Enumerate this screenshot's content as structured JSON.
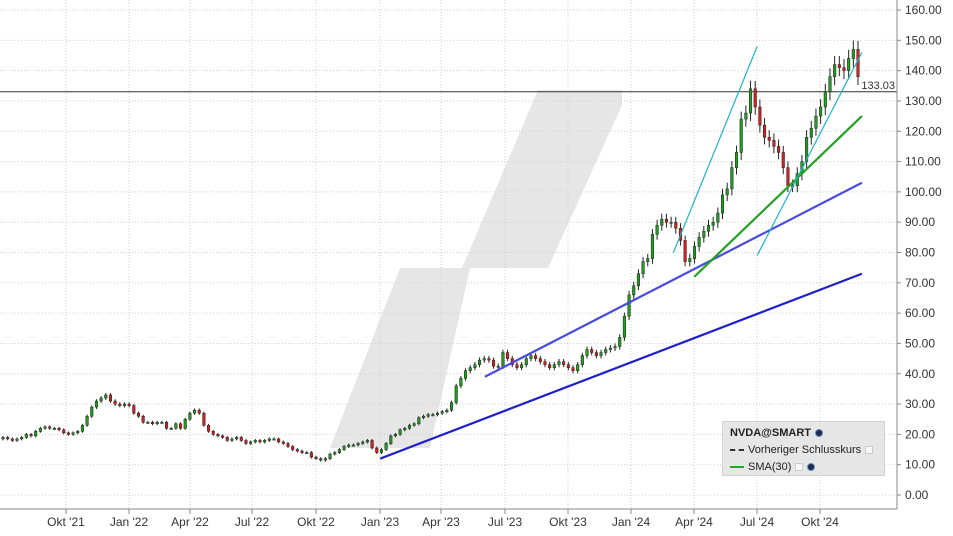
{
  "chart_data": {
    "type": "candlestick",
    "symbol": "NVDA@SMART",
    "ylim": [
      0,
      160
    ],
    "yticks": [
      "0.00",
      "10.00",
      "20.00",
      "30.00",
      "40.00",
      "50.00",
      "60.00",
      "70.00",
      "80.00",
      "90.00",
      "100.00",
      "110.00",
      "120.00",
      "130.00",
      "140.00",
      "150.00",
      "160.00"
    ],
    "x_categories": [
      "Okt '21",
      "Jan '22",
      "Apr '22",
      "Jul '22",
      "Okt '22",
      "Jan '23",
      "Apr '23",
      "Jul '23",
      "Okt '23",
      "Jan '24",
      "Apr '24",
      "Jul '24",
      "Okt '24"
    ],
    "previous_close": 133.03,
    "previous_close_label": "133.03",
    "grid": true,
    "legend_position": "bottom-right",
    "legend": {
      "title": "NVDA@SMART",
      "items": [
        {
          "label": "Vorheriger Schlusskurs",
          "style": "dashed"
        },
        {
          "label": "SMA(30)",
          "style": "solid"
        }
      ]
    },
    "closes": [
      19,
      18.5,
      18,
      18.5,
      19,
      20,
      19.5,
      21,
      22,
      22.5,
      22,
      22,
      21.5,
      20.5,
      20,
      20.5,
      21,
      23,
      26,
      29,
      31,
      32,
      33,
      31,
      30,
      29.5,
      30,
      29.5,
      27,
      26,
      24,
      24,
      23.5,
      24,
      24,
      22,
      22,
      23.5,
      22,
      25,
      27,
      28,
      27,
      23,
      21,
      20,
      19.5,
      19,
      18,
      18.5,
      19,
      18,
      17,
      17.5,
      18,
      17.5,
      18,
      18.5,
      18.5,
      17.5,
      17,
      16,
      15,
      14.5,
      14,
      14,
      12.5,
      12,
      11.5,
      12,
      13.5,
      14,
      15,
      16,
      16.5,
      16.5,
      17,
      17.5,
      18,
      15.5,
      14,
      15,
      17,
      19.5,
      20,
      21.5,
      22,
      23,
      23.5,
      25.5,
      26,
      26.5,
      26.5,
      27,
      27.5,
      28,
      30.5,
      36,
      38.5,
      41,
      42,
      43,
      44.5,
      45,
      44.5,
      42.5,
      42.5,
      47,
      45,
      43,
      42,
      43,
      45,
      46,
      45,
      44,
      43,
      42,
      43,
      44,
      43,
      42,
      41,
      43,
      46,
      48,
      47,
      46,
      47,
      48,
      48.5,
      49,
      52,
      59,
      66,
      69,
      73,
      77,
      78,
      86,
      89,
      91,
      90,
      90,
      88,
      84,
      77,
      78,
      82,
      85,
      87,
      89,
      90,
      93,
      99,
      101,
      108,
      113,
      124,
      126,
      134,
      128,
      122,
      118,
      117,
      115,
      113,
      108,
      102,
      102,
      106,
      110,
      118,
      121,
      125,
      128,
      133,
      138,
      142,
      141,
      140,
      144,
      147,
      138
    ],
    "trendlines": [
      {
        "from": [
          "Jan '23",
          12
        ],
        "to": [
          "Okt '24 +2m",
          73
        ],
        "color": "#1f1fcc"
      },
      {
        "from": [
          "Jun '23",
          39
        ],
        "to": [
          "Okt '24 +2m",
          103
        ],
        "color": "#4a4ae0"
      },
      {
        "from": [
          "Apr '24",
          72
        ],
        "to": [
          "Okt '24 +2m",
          125
        ],
        "color": "#22a022"
      },
      {
        "from": [
          "Mrz '24",
          80
        ],
        "to": [
          "Jul '24",
          148
        ],
        "color": "#1fb5c8"
      },
      {
        "from": [
          "Jul '24",
          79
        ],
        "to": [
          "Okt '24 +2m",
          146
        ],
        "color": "#1fb5c8"
      }
    ]
  }
}
